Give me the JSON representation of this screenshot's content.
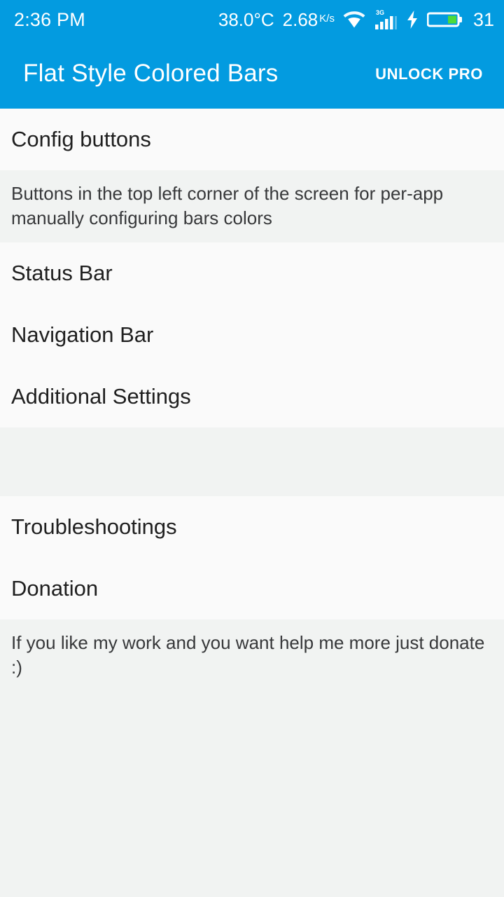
{
  "status_bar": {
    "clock": "2:36 PM",
    "temperature": "38.0°C",
    "network_speed_value": "2.68",
    "network_speed_unit": "K/s",
    "wifi_icon": "wifi-icon",
    "signal_icon": "signal-bars-icon",
    "signal_network_label": "3G",
    "charging_icon": "charging-bolt-icon",
    "battery_icon": "battery-icon",
    "battery_level": "31",
    "background_color": "#039be0",
    "foreground_color": "#ffffff",
    "battery_fill_color": "#4ddb39"
  },
  "toolbar": {
    "title": "Flat Style Colored Bars",
    "action_label": "UNLOCK PRO",
    "background_color": "#039be0"
  },
  "preferences": {
    "group_one": [
      {
        "title": "Config buttons",
        "summary": "Buttons in the top left corner of the screen for per-app manually configuring bars colors"
      },
      {
        "title": "Status Bar",
        "summary": ""
      },
      {
        "title": "Navigation Bar",
        "summary": ""
      },
      {
        "title": "Additional Settings",
        "summary": ""
      }
    ],
    "group_two": [
      {
        "title": "Troubleshootings",
        "summary": ""
      },
      {
        "title": "Donation",
        "summary": "If you like my work and you want help me more just donate :)"
      }
    ]
  },
  "theme": {
    "list_background": "#fafafa",
    "summary_background": "#f1f3f2",
    "title_text_color": "#1f1f1f",
    "summary_text_color": "#37383a"
  }
}
